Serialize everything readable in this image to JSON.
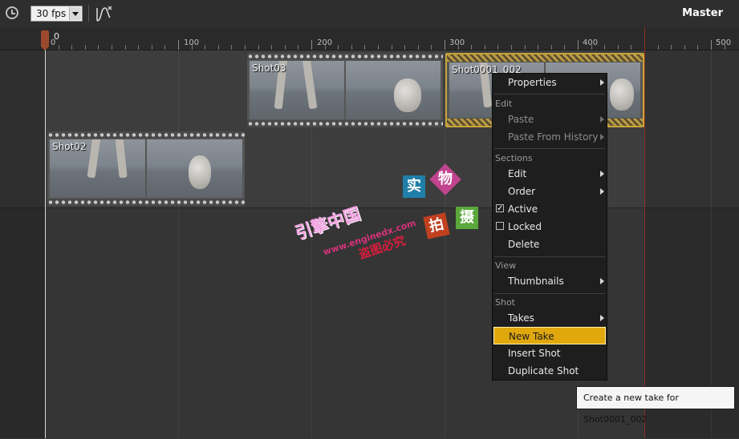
{
  "toolbar": {
    "clock_icon": "clock-icon",
    "fps_value": "30 fps",
    "curve_icon": "curve-editor-icon",
    "title": "Master"
  },
  "ruler": {
    "playhead_value": "0",
    "labels": [
      "0",
      "100",
      "200",
      "300",
      "400",
      "500"
    ]
  },
  "shots": [
    {
      "name": "Shot03"
    },
    {
      "name": "Shot0001_002"
    },
    {
      "name": "Shot02"
    }
  ],
  "watermark": {
    "line1": "引擎中国",
    "line2": "www.enginedx.com",
    "line3": "盗图必究",
    "chars": [
      "实",
      "物",
      "拍",
      "摄"
    ]
  },
  "menu": {
    "properties": "Properties",
    "edit_header": "Edit",
    "paste": "Paste",
    "paste_history": "Paste From History",
    "sections_header": "Sections",
    "edit": "Edit",
    "order": "Order",
    "active": "Active",
    "locked": "Locked",
    "delete": "Delete",
    "view_header": "View",
    "thumbnails": "Thumbnails",
    "shot_header": "Shot",
    "takes": "Takes",
    "new_take": "New Take",
    "insert_shot": "Insert Shot",
    "duplicate_shot": "Duplicate Shot",
    "active_checked": true,
    "locked_checked": false
  },
  "tooltip": "Create a new take for Shot0001_002",
  "colors": {
    "highlight": "#e1a80e",
    "end_marker": "#8a3020",
    "playhead": "#9c4a2d"
  }
}
